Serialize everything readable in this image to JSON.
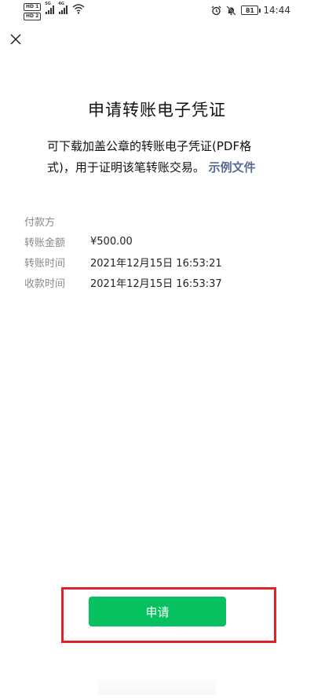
{
  "status_bar": {
    "badge_top": "HD 1",
    "badge_bottom": "HD 2",
    "net1": "5G",
    "net2": "4G",
    "battery": "81",
    "time": "14:44"
  },
  "page": {
    "title": "申请转账电子凭证",
    "description": "可下载加盖公章的转账电子凭证(PDF格式)，用于证明该笔转账交易。",
    "sample_link": "示例文件"
  },
  "info": {
    "payer_label": "付款方",
    "payer_value": "",
    "amount_label": "转账金额",
    "amount_value": "¥500.00",
    "transfer_time_label": "转账时间",
    "transfer_time_value": "2021年12月15日 16:53:21",
    "receive_time_label": "收款时间",
    "receive_time_value": "2021年12月15日 16:53:37"
  },
  "actions": {
    "apply_label": "申请"
  },
  "colors": {
    "primary_green": "#07c160",
    "link_blue": "#576b95",
    "highlight_red": "#e02129"
  }
}
